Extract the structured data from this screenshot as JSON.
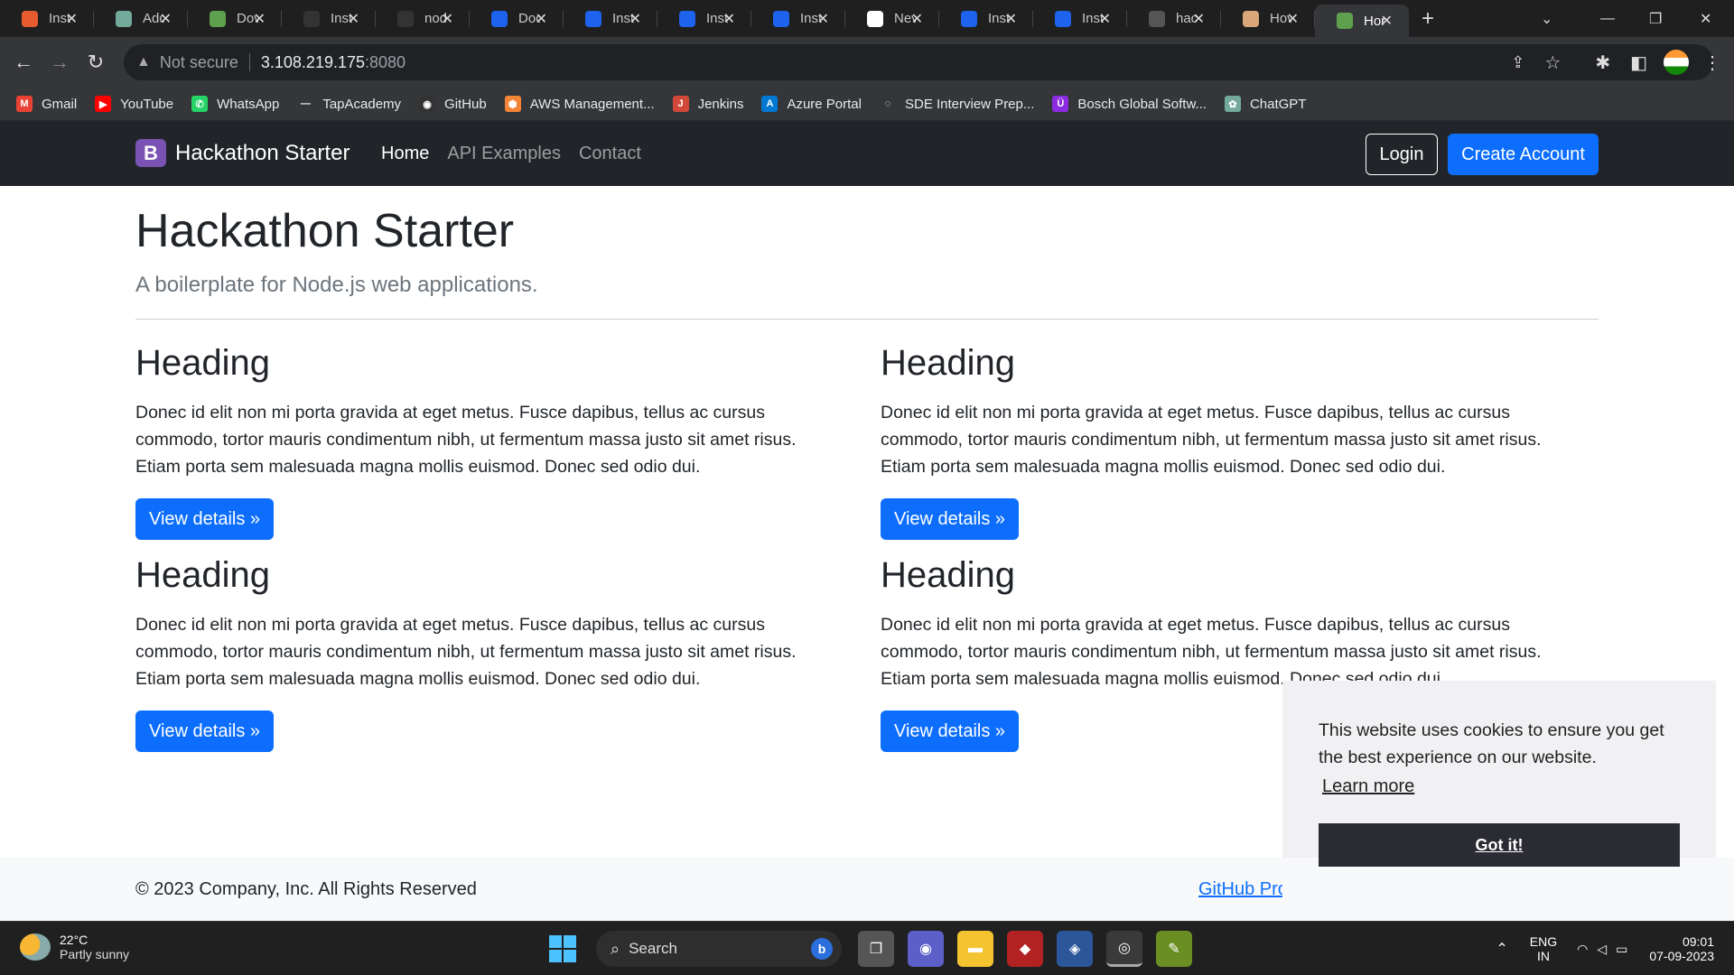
{
  "browser": {
    "tabs": [
      {
        "title": "Inst",
        "icon": "orange-square-icon",
        "color": "#e65c2f"
      },
      {
        "title": "Add",
        "icon": "chatgpt-icon",
        "color": "#74aa9c"
      },
      {
        "title": "Dov",
        "icon": "node-hex-icon",
        "color": "#5fa04e"
      },
      {
        "title": "Inst",
        "icon": "github-icon",
        "color": "#333333"
      },
      {
        "title": "nod",
        "icon": "github-icon",
        "color": "#333333"
      },
      {
        "title": "Doc",
        "icon": "docker-whale-icon",
        "color": "#1d63ed"
      },
      {
        "title": "Inst",
        "icon": "docker-whale-icon",
        "color": "#1d63ed"
      },
      {
        "title": "Inst",
        "icon": "docker-whale-icon",
        "color": "#1d63ed"
      },
      {
        "title": "Inst",
        "icon": "docker-whale-icon",
        "color": "#1d63ed"
      },
      {
        "title": "Nev",
        "icon": "chrome-icon",
        "color": "#ffffff"
      },
      {
        "title": "Inst",
        "icon": "docker-whale-icon",
        "color": "#1d63ed"
      },
      {
        "title": "Inst",
        "icon": "docker-whale-icon",
        "color": "#1d63ed"
      },
      {
        "title": "hac",
        "icon": "github-icon",
        "color": "#555555"
      },
      {
        "title": "Hov",
        "icon": "avatar-icon",
        "color": "#d9a77a"
      },
      {
        "title": "Hor",
        "icon": "node-hex-icon",
        "color": "#5fa04e"
      }
    ],
    "address": {
      "warning": "Not secure",
      "host": "3.108.219.175",
      "port": ":8080"
    },
    "bookmarks": [
      {
        "label": "Gmail",
        "color": "#ea4335",
        "glyph": "M"
      },
      {
        "label": "YouTube",
        "color": "#ff0000",
        "glyph": "▶"
      },
      {
        "label": "WhatsApp",
        "color": "#25d366",
        "glyph": "✆"
      },
      {
        "label": "TapAcademy",
        "color": "#35363a",
        "glyph": "—"
      },
      {
        "label": "GitHub",
        "color": "#333333",
        "glyph": "◉"
      },
      {
        "label": "AWS Management...",
        "color": "#f58536",
        "glyph": "⬢"
      },
      {
        "label": "Jenkins",
        "color": "#d24939",
        "glyph": "J"
      },
      {
        "label": "Azure Portal",
        "color": "#0078d4",
        "glyph": "A"
      },
      {
        "label": "SDE Interview Prep...",
        "color": "#35363a",
        "glyph": "◌"
      },
      {
        "label": "Bosch Global Softw...",
        "color": "#8a2be2",
        "glyph": "Ü"
      },
      {
        "label": "ChatGPT",
        "color": "#74aa9c",
        "glyph": "✿"
      }
    ]
  },
  "site": {
    "brand_letter": "B",
    "brand_name": "Hackathon Starter",
    "nav": [
      "Home",
      "API Examples",
      "Contact"
    ],
    "login": "Login",
    "create_account": "Create Account",
    "hero_title": "Hackathon Starter",
    "hero_lead": "A boilerplate for Node.js web applications.",
    "cards": [
      {
        "heading": "Heading",
        "text": "Donec id elit non mi porta gravida at eget metus. Fusce dapibus, tellus ac cursus commodo, tortor mauris condimentum nibh, ut fermentum massa justo sit amet risus. Etiam porta sem malesuada magna mollis euismod. Donec sed odio dui.",
        "button": "View details »"
      },
      {
        "heading": "Heading",
        "text": "Donec id elit non mi porta gravida at eget metus. Fusce dapibus, tellus ac cursus commodo, tortor mauris condimentum nibh, ut fermentum massa justo sit amet risus. Etiam porta sem malesuada magna mollis euismod. Donec sed odio dui.",
        "button": "View details »"
      },
      {
        "heading": "Heading",
        "text": "Donec id elit non mi porta gravida at eget metus. Fusce dapibus, tellus ac cursus commodo, tortor mauris condimentum nibh, ut fermentum massa justo sit amet risus. Etiam porta sem malesuada magna mollis euismod. Donec sed odio dui.",
        "button": "View details »"
      },
      {
        "heading": "Heading",
        "text": "Donec id elit non mi porta gravida at eget metus. Fusce dapibus, tellus ac cursus commodo, tortor mauris condimentum nibh, ut fermentum massa justo sit amet risus. Etiam porta sem malesuada magna mollis euismod. Donec sed odio dui.",
        "button": "View details »"
      }
    ],
    "footer_copy": "© 2023 Company, Inc. All Rights Reserved",
    "footer_link": "GitHub Pro"
  },
  "cookie": {
    "message": "This website uses cookies to ensure you get the best experience on our website.",
    "learn_more": "Learn more",
    "accept": "Got it!"
  },
  "taskbar": {
    "temperature": "22°C",
    "weather": "Partly sunny",
    "search": "Search",
    "lang": "ENG",
    "region": "IN",
    "time": "09:01",
    "date": "07-09-2023"
  }
}
